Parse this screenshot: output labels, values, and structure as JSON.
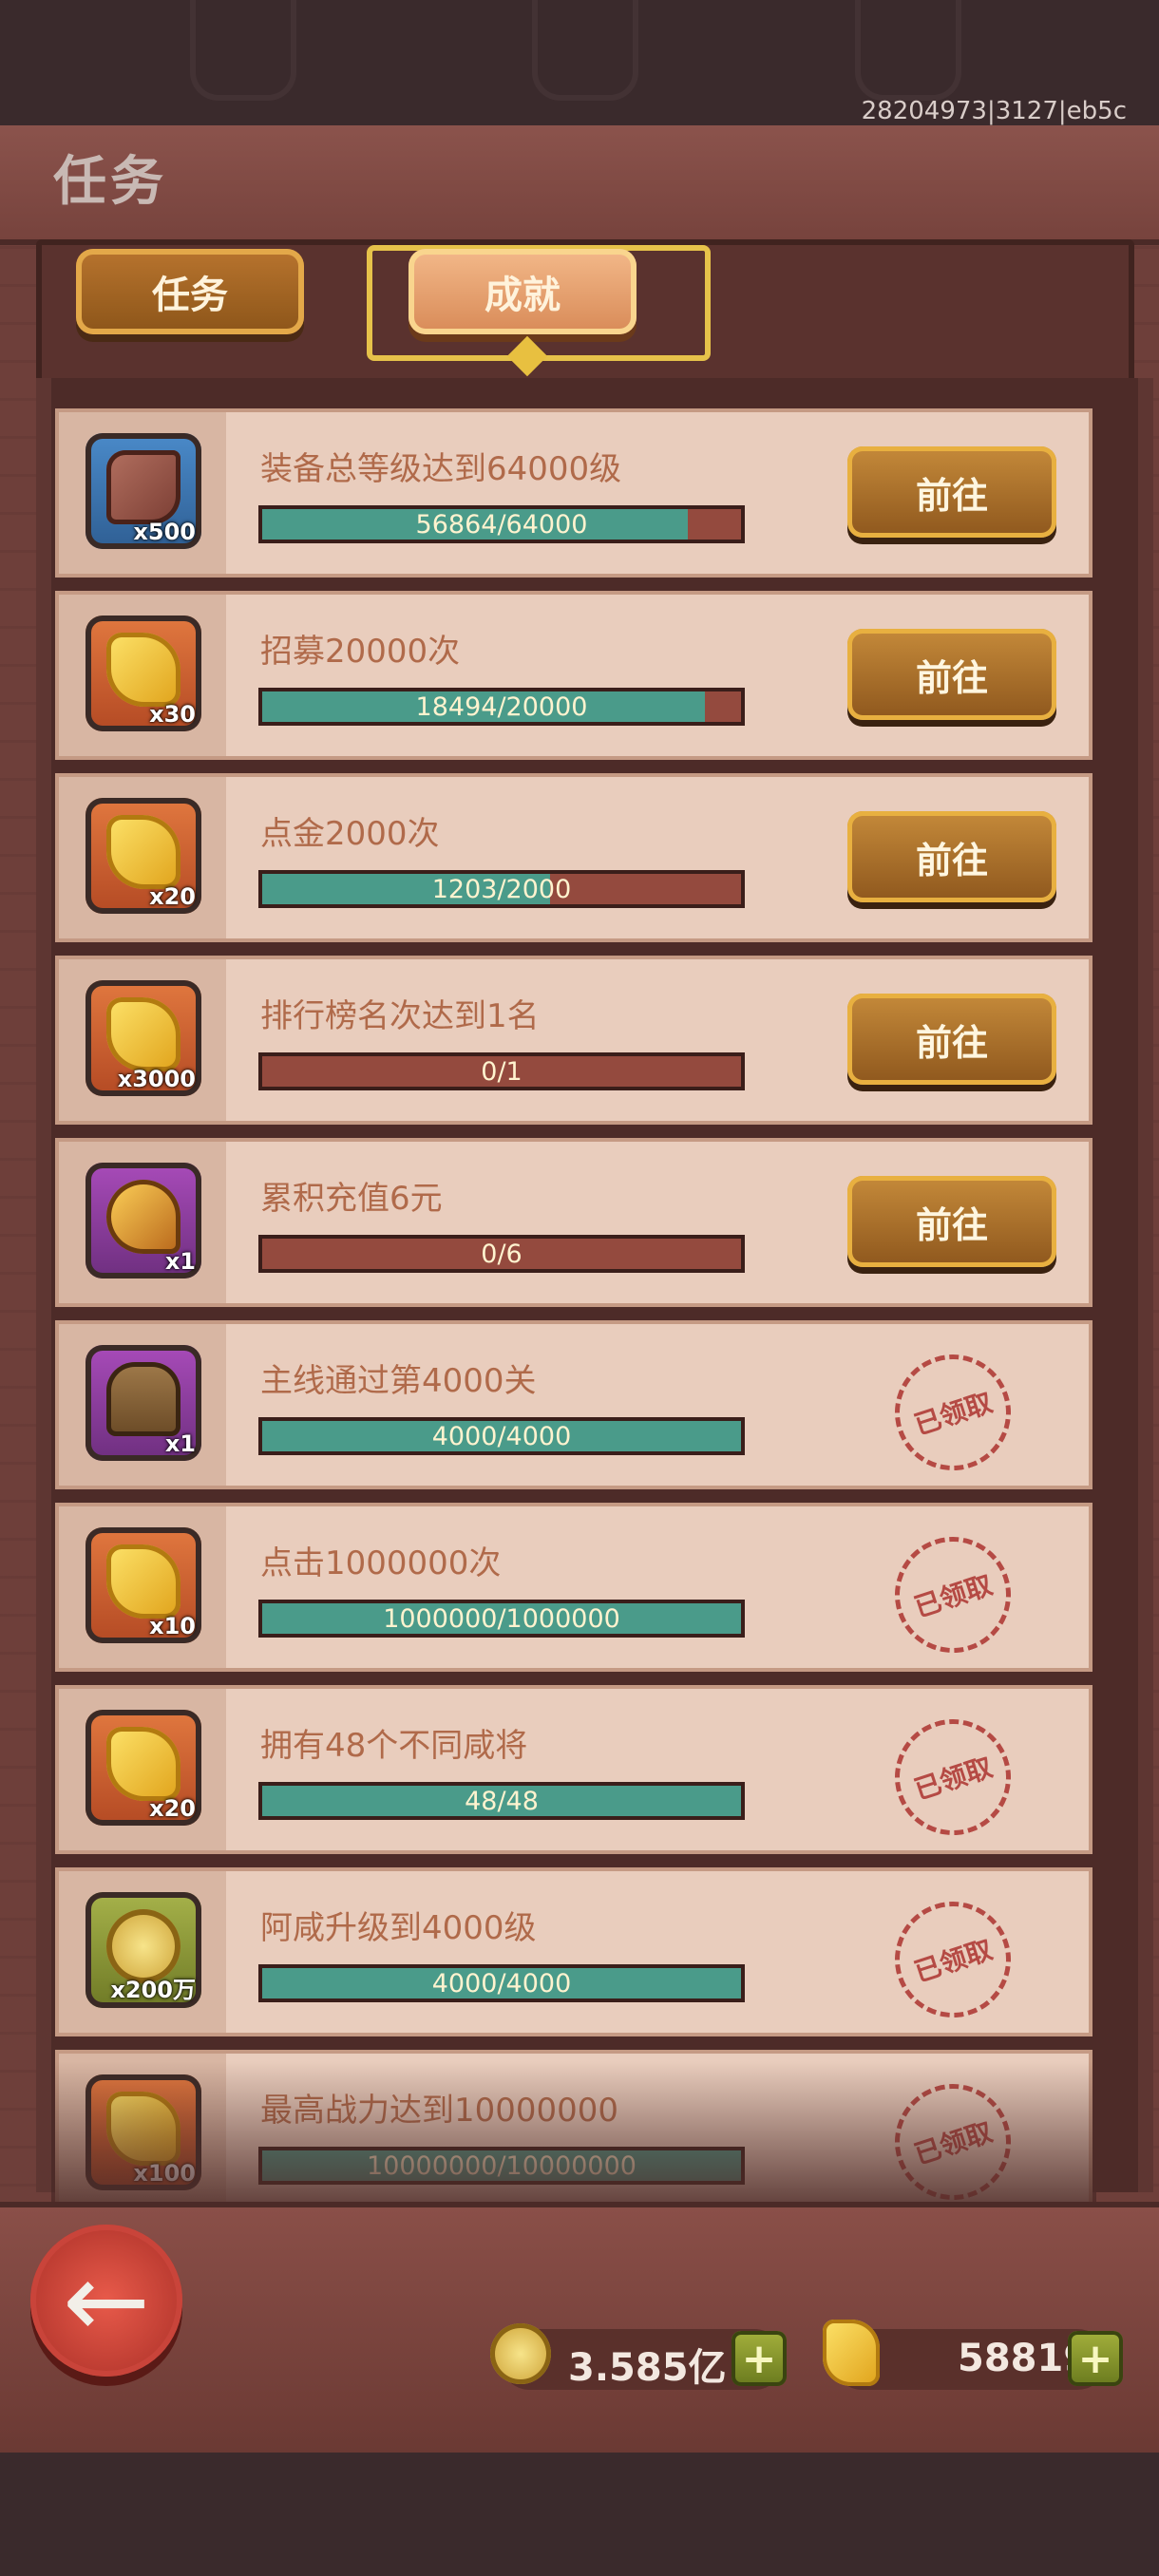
{
  "header": {
    "title": "任务",
    "build_id": "28204973|3127|eb5c"
  },
  "tabs": [
    {
      "label": "任务",
      "active": false
    },
    {
      "label": "成就",
      "active": true
    }
  ],
  "achievements": [
    {
      "task": "装备总等级达到64000级",
      "progress_text": "56864/64000",
      "progress": 0.8885,
      "reward_qty": "x500",
      "reward_icon": "equipment-stone-icon",
      "reward_color": "blue",
      "action": "前往",
      "claimed": false
    },
    {
      "task": "招募20000次",
      "progress_text": "18494/20000",
      "progress": 0.9247,
      "reward_qty": "x30",
      "reward_icon": "recruit-scroll-icon",
      "reward_color": "orange",
      "action": "前往",
      "claimed": false
    },
    {
      "task": "点金2000次",
      "progress_text": "1203/2000",
      "progress": 0.6015,
      "reward_qty": "x20",
      "reward_icon": "recruit-scroll-icon",
      "reward_color": "orange",
      "action": "前往",
      "claimed": false
    },
    {
      "task": "排行榜名次达到1名",
      "progress_text": "0/1",
      "progress": 0,
      "reward_qty": "x3000",
      "reward_icon": "recruit-scroll-icon",
      "reward_color": "orange",
      "action": "前往",
      "claimed": false
    },
    {
      "task": "累积充值6元",
      "progress_text": "0/6",
      "progress": 0,
      "reward_qty": "x1",
      "reward_icon": "golden-torch-icon",
      "reward_color": "purple",
      "action": "前往",
      "claimed": false
    },
    {
      "task": "主线通过第4000关",
      "progress_text": "4000/4000",
      "progress": 1,
      "reward_qty": "x1",
      "reward_icon": "treasure-chest-icon",
      "reward_color": "purple",
      "claimed_label": "已领取",
      "claimed": true
    },
    {
      "task": "点击1000000次",
      "progress_text": "1000000/1000000",
      "progress": 1,
      "reward_qty": "x10",
      "reward_icon": "recruit-scroll-icon",
      "reward_color": "orange",
      "claimed_label": "已领取",
      "claimed": true
    },
    {
      "task": "拥有48个不同咸将",
      "progress_text": "48/48",
      "progress": 1,
      "reward_qty": "x20",
      "reward_icon": "recruit-scroll-icon",
      "reward_color": "orange",
      "claimed_label": "已领取",
      "claimed": true
    },
    {
      "task": "阿咸升级到4000级",
      "progress_text": "4000/4000",
      "progress": 1,
      "reward_qty": "x200万",
      "reward_icon": "copper-coin-icon",
      "reward_color": "green",
      "claimed_label": "已领取",
      "claimed": true
    },
    {
      "task": "最高战力达到10000000",
      "progress_text": "10000000/10000000",
      "progress": 1,
      "reward_qty": "x100",
      "reward_icon": "recruit-scroll-icon",
      "reward_color": "orange",
      "claimed_label": "已领取",
      "claimed": true
    }
  ],
  "footer": {
    "coins": "3.585亿",
    "scrolls": "58819"
  }
}
